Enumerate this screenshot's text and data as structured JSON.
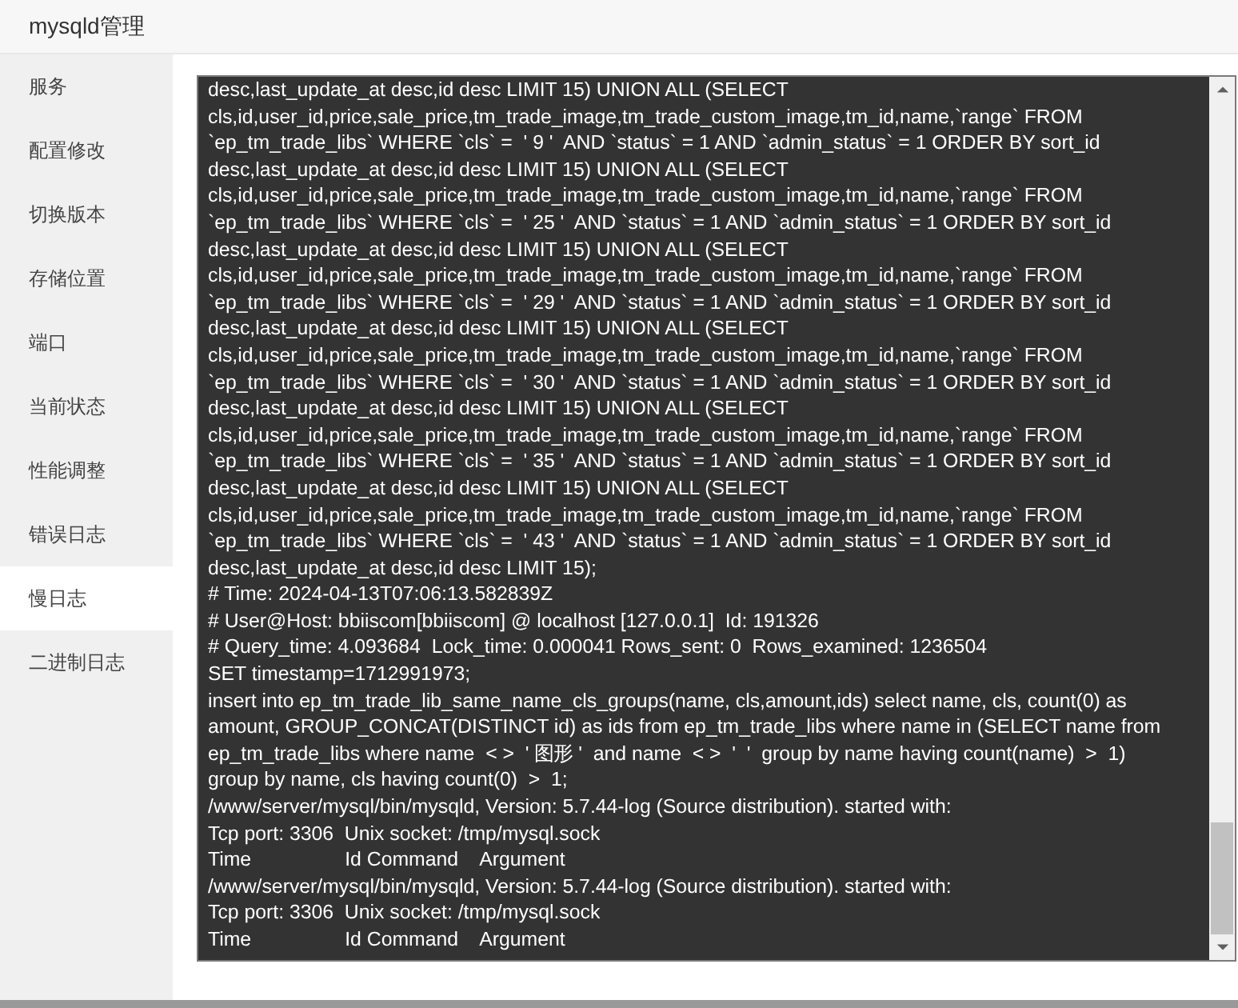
{
  "window": {
    "title": "mysqld管理"
  },
  "sidebar": {
    "items": [
      {
        "label": "服务",
        "selected": false
      },
      {
        "label": "配置修改",
        "selected": false
      },
      {
        "label": "切换版本",
        "selected": false
      },
      {
        "label": "存储位置",
        "selected": false
      },
      {
        "label": "端口",
        "selected": false
      },
      {
        "label": "当前状态",
        "selected": false
      },
      {
        "label": "性能调整",
        "selected": false
      },
      {
        "label": "错误日志",
        "selected": false
      },
      {
        "label": "慢日志",
        "selected": true
      },
      {
        "label": "二进制日志",
        "selected": false
      }
    ]
  },
  "log": {
    "lines": [
      "desc,last_update_at desc,id desc LIMIT 15) UNION ALL (SELECT",
      "cls,id,user_id,price,sale_price,tm_trade_image,tm_trade_custom_image,tm_id,name,`range` FROM",
      "`ep_tm_trade_libs` WHERE `cls` =  ' 9 '  AND `status` = 1 AND `admin_status` = 1 ORDER BY sort_id",
      "desc,last_update_at desc,id desc LIMIT 15) UNION ALL (SELECT",
      "cls,id,user_id,price,sale_price,tm_trade_image,tm_trade_custom_image,tm_id,name,`range` FROM",
      "`ep_tm_trade_libs` WHERE `cls` =  ' 25 '  AND `status` = 1 AND `admin_status` = 1 ORDER BY sort_id",
      "desc,last_update_at desc,id desc LIMIT 15) UNION ALL (SELECT",
      "cls,id,user_id,price,sale_price,tm_trade_image,tm_trade_custom_image,tm_id,name,`range` FROM",
      "`ep_tm_trade_libs` WHERE `cls` =  ' 29 '  AND `status` = 1 AND `admin_status` = 1 ORDER BY sort_id",
      "desc,last_update_at desc,id desc LIMIT 15) UNION ALL (SELECT",
      "cls,id,user_id,price,sale_price,tm_trade_image,tm_trade_custom_image,tm_id,name,`range` FROM",
      "`ep_tm_trade_libs` WHERE `cls` =  ' 30 '  AND `status` = 1 AND `admin_status` = 1 ORDER BY sort_id",
      "desc,last_update_at desc,id desc LIMIT 15) UNION ALL (SELECT",
      "cls,id,user_id,price,sale_price,tm_trade_image,tm_trade_custom_image,tm_id,name,`range` FROM",
      "`ep_tm_trade_libs` WHERE `cls` =  ' 35 '  AND `status` = 1 AND `admin_status` = 1 ORDER BY sort_id",
      "desc,last_update_at desc,id desc LIMIT 15) UNION ALL (SELECT",
      "cls,id,user_id,price,sale_price,tm_trade_image,tm_trade_custom_image,tm_id,name,`range` FROM",
      "`ep_tm_trade_libs` WHERE `cls` =  ' 43 '  AND `status` = 1 AND `admin_status` = 1 ORDER BY sort_id",
      "desc,last_update_at desc,id desc LIMIT 15);",
      "# Time: 2024-04-13T07:06:13.582839Z",
      "# User@Host: bbiiscom[bbiiscom] @ localhost [127.0.0.1]  Id: 191326",
      "# Query_time: 4.093684  Lock_time: 0.000041 Rows_sent: 0  Rows_examined: 1236504",
      "SET timestamp=1712991973;",
      "insert into ep_tm_trade_lib_same_name_cls_groups(name, cls,amount,ids) select name, cls, count(0) as",
      "amount, GROUP_CONCAT(DISTINCT id) as ids from ep_tm_trade_libs where name in (SELECT name from",
      "ep_tm_trade_libs where name  < >  ' 图形 '  and name  < >  '  '  group by name having count(name)  >  1)",
      "group by name, cls having count(0)  >  1;",
      "/www/server/mysql/bin/mysqld, Version: 5.7.44-log (Source distribution). started with:",
      "Tcp port: 3306  Unix socket: /tmp/mysql.sock",
      "Time                 Id Command    Argument",
      "/www/server/mysql/bin/mysqld, Version: 5.7.44-log (Source distribution). started with:",
      "Tcp port: 3306  Unix socket: /tmp/mysql.sock",
      "Time                 Id Command    Argument"
    ]
  }
}
